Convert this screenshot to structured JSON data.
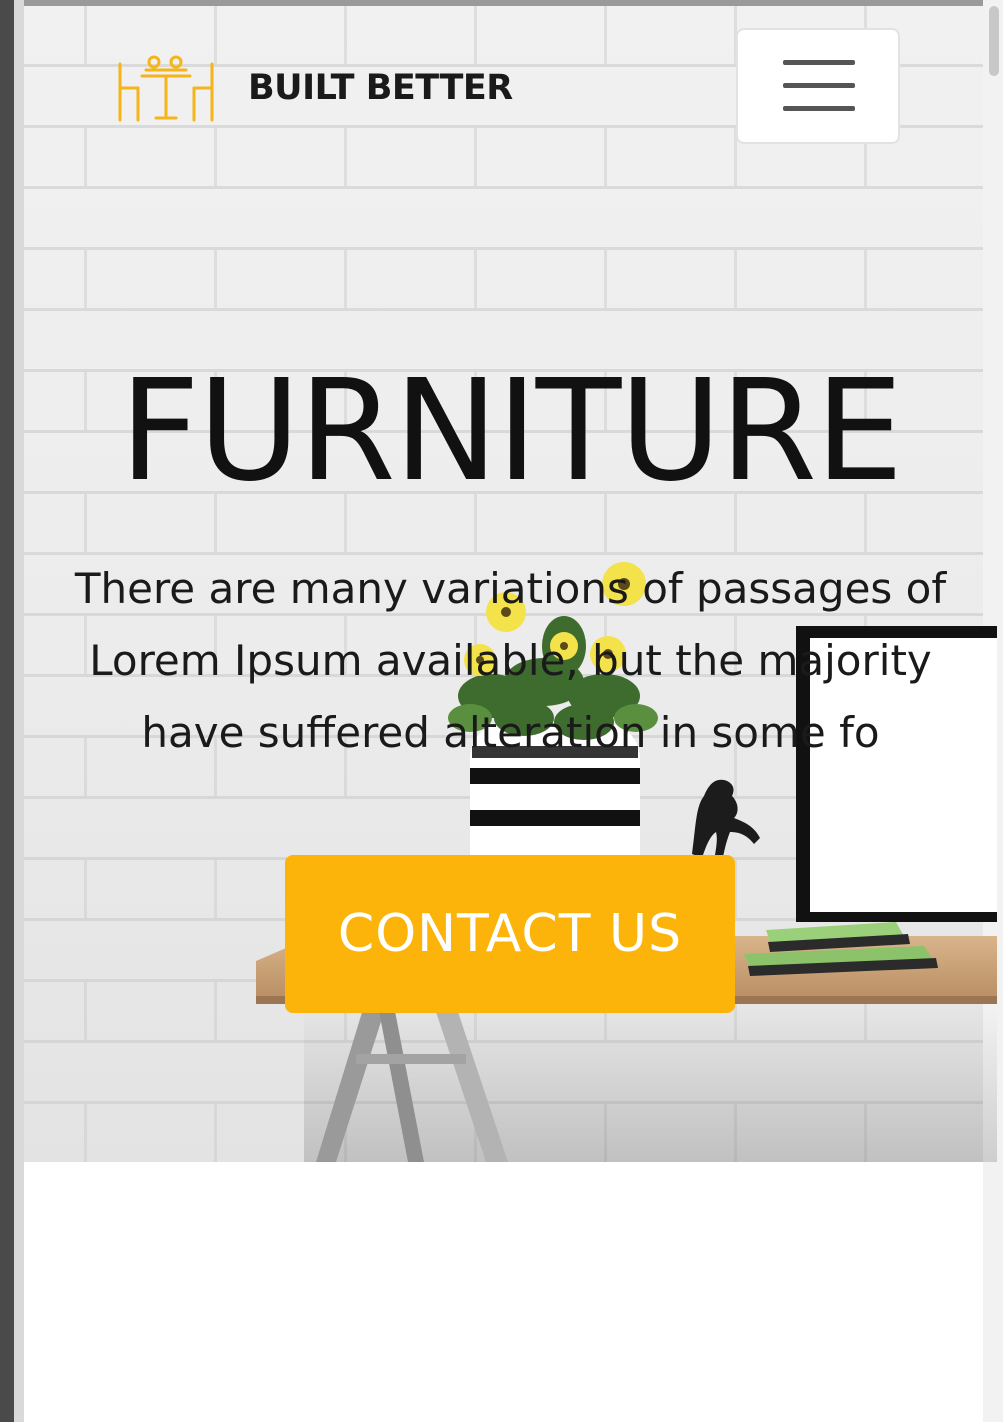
{
  "brand": {
    "name": "BUILT BETTER",
    "logo_icon": "table-chairs-logo-icon",
    "accent_color": "#fcb40a"
  },
  "nav": {
    "menu_icon": "hamburger-menu-icon"
  },
  "hero": {
    "title": "FURNITURE",
    "description": "There are many variations of passages of Lorem Ipsum available, but the majority have suffered alteration in some fo",
    "cta_label": "CONTACT US",
    "cta_color": "#fcb40a"
  }
}
